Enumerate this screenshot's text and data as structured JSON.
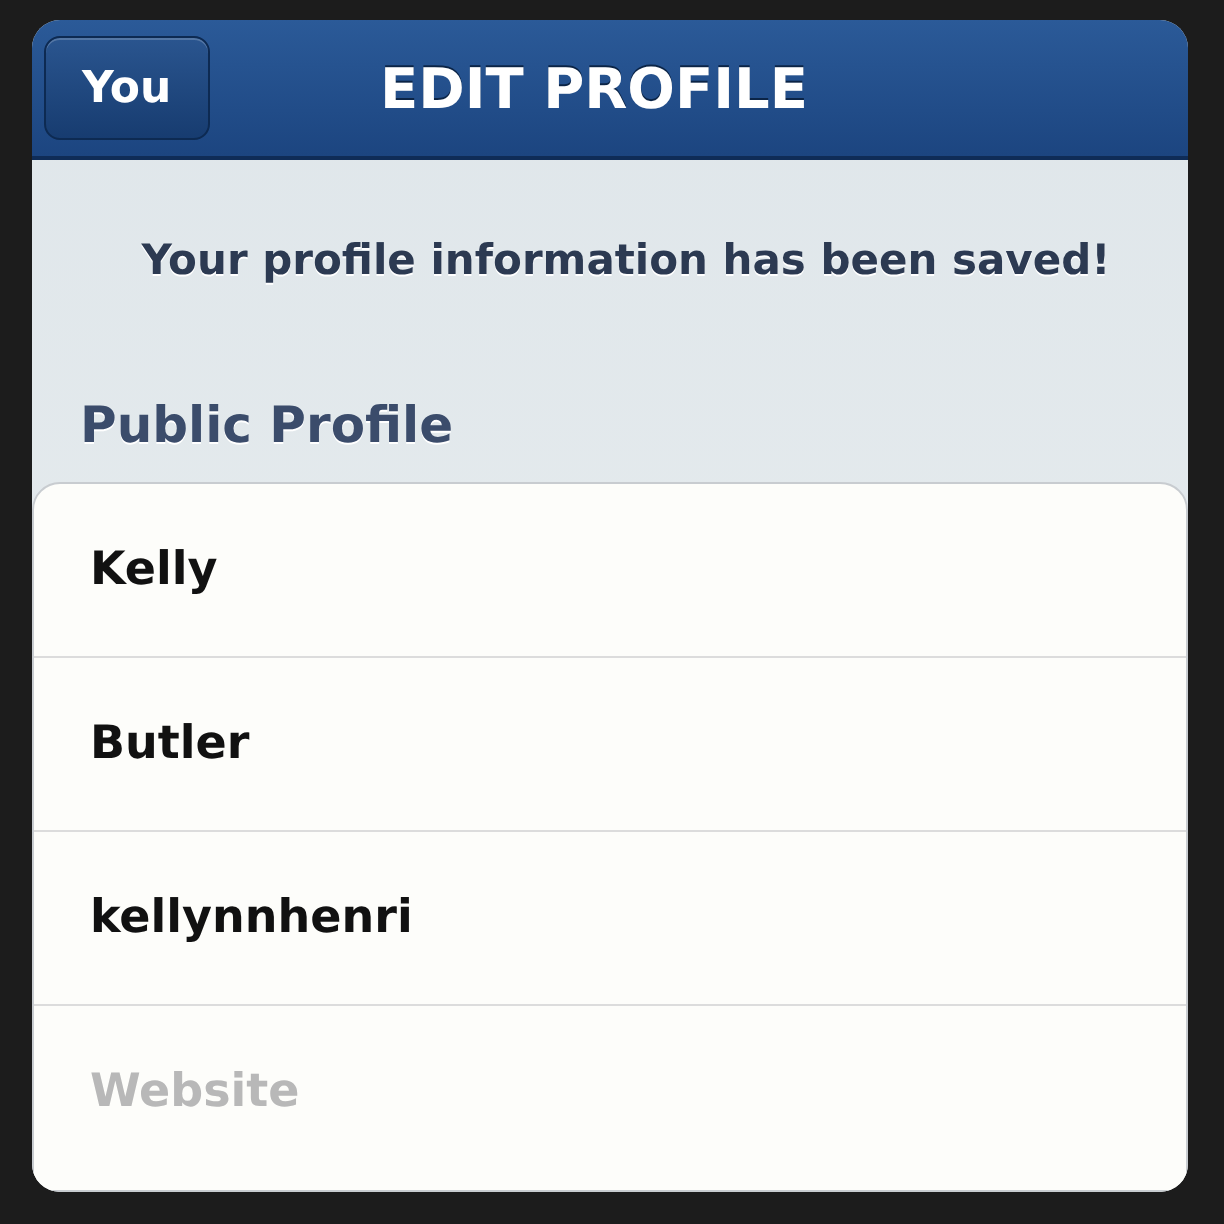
{
  "nav_bar": {
    "back_button": "You",
    "title": "EDIT PROFILE"
  },
  "message": "Your profile information has been saved!",
  "section": {
    "title": "Public Profile",
    "fields": [
      {
        "value": "Kelly"
      },
      {
        "value": "Butler"
      },
      {
        "value": "kellynnhenri"
      },
      {
        "placeholder": "Website"
      }
    ]
  }
}
